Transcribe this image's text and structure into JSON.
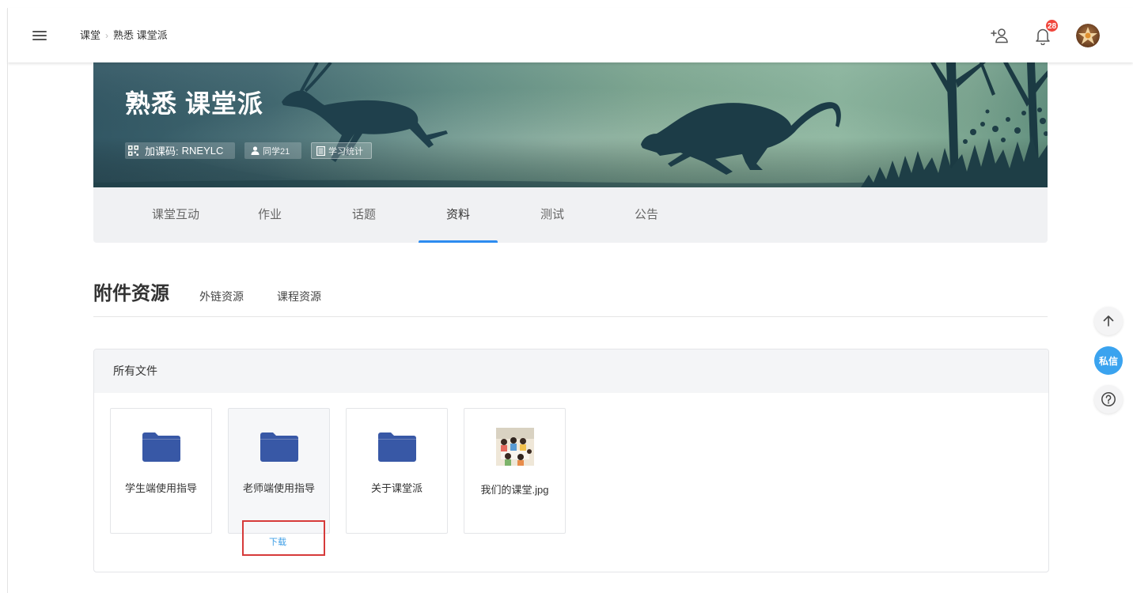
{
  "header": {
    "breadcrumb": [
      {
        "label": "课堂"
      },
      {
        "label": "熟悉 课堂派"
      }
    ],
    "breadcrumb_separator": "›",
    "notification_count": "28",
    "icons": {
      "menu": "menu-icon",
      "add_user": "add-user-icon",
      "notifications": "bell-icon",
      "profile": "avatar"
    }
  },
  "course": {
    "title": "熟悉 课堂派",
    "join_code_label": "加课码:",
    "join_code": "RNEYLC",
    "students": "同学21",
    "stats": "学习统计",
    "icons": {
      "join_code": "qr-code-icon",
      "students": "person-icon",
      "stats": "document-icon"
    }
  },
  "tabs": [
    {
      "label": "课堂互动",
      "active": false
    },
    {
      "label": "作业",
      "active": false
    },
    {
      "label": "话题",
      "active": false
    },
    {
      "label": "资料",
      "active": true
    },
    {
      "label": "测试",
      "active": false
    },
    {
      "label": "公告",
      "active": false
    }
  ],
  "resources": {
    "title": "附件资源",
    "subtabs": [
      "外链资源",
      "课程资源"
    ]
  },
  "files_panel": {
    "title": "所有文件",
    "download_label": "下载",
    "files": [
      {
        "name": "学生端使用指导",
        "type": "folder",
        "icon": "folder-icon",
        "hovered": false
      },
      {
        "name": "老师端使用指导",
        "type": "folder",
        "icon": "folder-icon",
        "hovered": true
      },
      {
        "name": "关于课堂派",
        "type": "folder",
        "icon": "folder-icon",
        "hovered": false
      },
      {
        "name": "我们的课堂.jpg",
        "type": "image",
        "icon": "photo-thumbnail",
        "hovered": false
      }
    ]
  },
  "float_buttons": {
    "message_label": "私信",
    "icons": {
      "back_to_top": "arrow-up-icon",
      "help": "help-icon"
    }
  },
  "colors": {
    "accent": "#2d8cf0",
    "folder": "#3858a6",
    "download_link": "#3d9ee6",
    "highlight_box": "#d63a3a",
    "message_button": "#3aa3ef",
    "notification_badge": "#f0463c"
  }
}
